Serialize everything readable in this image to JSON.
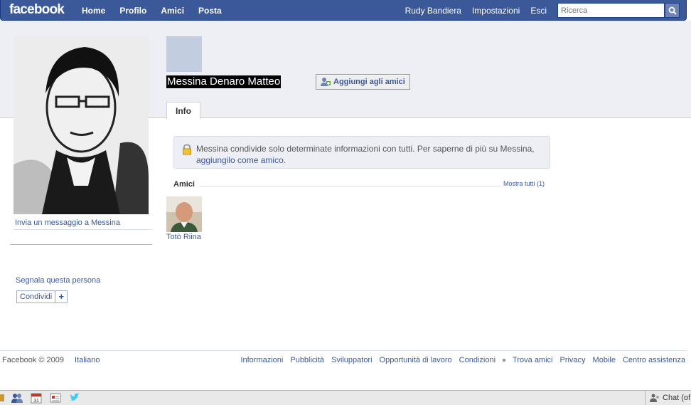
{
  "topbar": {
    "logo": "facebook",
    "nav": [
      "Home",
      "Profilo",
      "Amici",
      "Posta"
    ],
    "user_name": "Rudy Bandiera",
    "settings": "Impostazioni",
    "logout": "Esci",
    "search_placeholder": "Ricerca"
  },
  "left": {
    "message_link": "Invia un messaggio a Messina",
    "report_link": "Segnala questa persona",
    "share_label": "Condividi",
    "share_plus": "+"
  },
  "profile": {
    "name": "Messina Denaro Matteo",
    "add_friend": "Aggiungi agli amici",
    "tab_info": "Info"
  },
  "notice": {
    "text": "Messina condivide solo determinate informazioni con tutti. Per saperne di più su Messina, ",
    "link": "aggiungilo come amico",
    "end": "."
  },
  "friends": {
    "title": "Amici",
    "show_all": "Mostra tutti (1)",
    "items": [
      {
        "name": "Totò Riina"
      }
    ]
  },
  "footer": {
    "copyright": "Facebook © 2009",
    "language": "Italiano",
    "links_a": [
      "Informazioni",
      "Pubblicità",
      "Sviluppatori",
      "Opportunità di lavoro",
      "Condizioni"
    ],
    "links_b": [
      "Trova amici",
      "Privacy",
      "Mobile",
      "Centro assistenza"
    ]
  },
  "chatbar": {
    "chat_label": "Chat (of"
  },
  "colors": {
    "brand_blue": "#3b5998",
    "band_gray": "#edeff4"
  }
}
